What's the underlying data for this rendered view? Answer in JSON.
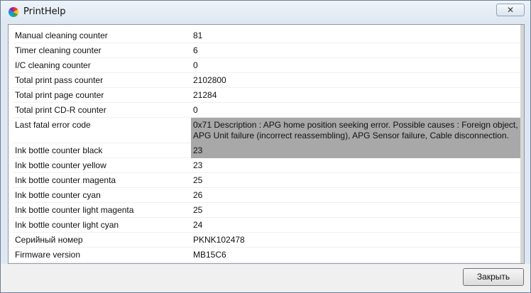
{
  "window": {
    "title": "PrintHelp",
    "close_glyph": "✕"
  },
  "table": {
    "rows": [
      {
        "label": "Manual cleaning counter",
        "value": "81"
      },
      {
        "label": "Timer cleaning counter",
        "value": "6"
      },
      {
        "label": "I/C cleaning counter",
        "value": "0"
      },
      {
        "label": "Total print pass counter",
        "value": "2102800"
      },
      {
        "label": "Total print page counter",
        "value": "21284"
      },
      {
        "label": "Total print CD-R counter",
        "value": "0"
      },
      {
        "label": "Last fatal error code",
        "value": "0x71 Description : APG home position seeking error. Possible causes : Foreign object, APG Unit failure (incorrect reassembling), APG Sensor failure, Cable disconnection."
      },
      {
        "label": "Ink bottle counter black",
        "value": "23"
      },
      {
        "label": "Ink bottle counter yellow",
        "value": "23"
      },
      {
        "label": "Ink bottle counter magenta",
        "value": "25"
      },
      {
        "label": "Ink bottle counter cyan",
        "value": "26"
      },
      {
        "label": "Ink bottle counter light magenta",
        "value": "25"
      },
      {
        "label": "Ink bottle counter light cyan",
        "value": "24"
      },
      {
        "label": "Серийный номер",
        "value": "PKNK102478"
      },
      {
        "label": "Firmware version",
        "value": "MB15C6"
      }
    ]
  },
  "footer": {
    "close_label": "Закрыть"
  },
  "colors": {
    "selected_row_bg": "#a8a8a8"
  }
}
